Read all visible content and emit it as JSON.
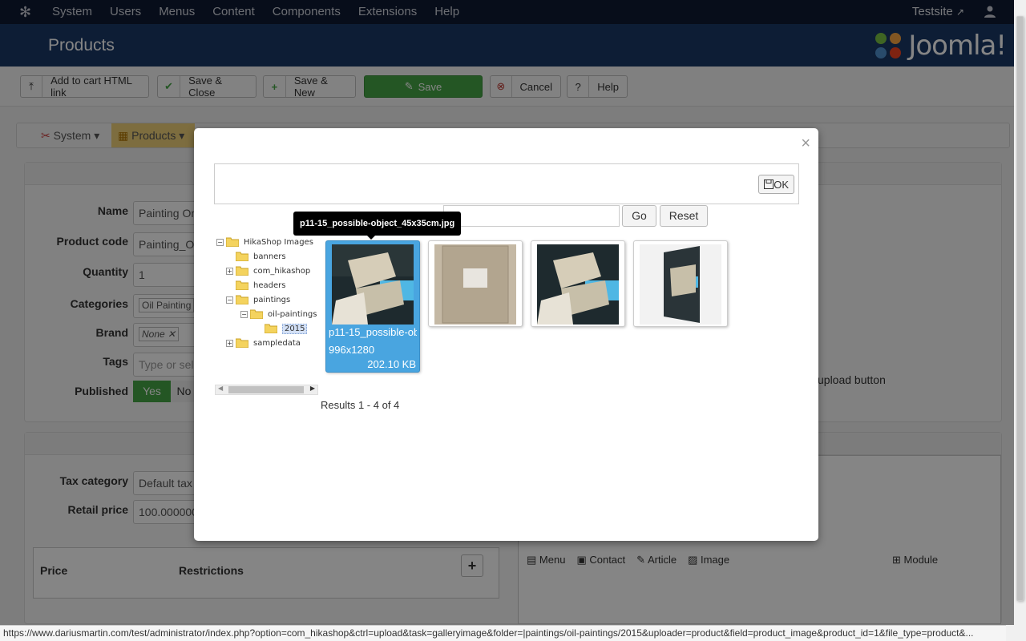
{
  "topnav": {
    "items": [
      "System",
      "Users",
      "Menus",
      "Content",
      "Components",
      "Extensions",
      "Help"
    ],
    "site_link": "Testsite"
  },
  "header": {
    "title": "Products",
    "brand": "Joomla!"
  },
  "toolbar": {
    "add_to_cart": "Add to cart HTML link",
    "save_close": "Save & Close",
    "save_new": "Save & New",
    "save": "Save",
    "cancel": "Cancel",
    "help": "Help"
  },
  "subnav": {
    "system": "System",
    "products": "Products"
  },
  "form": {
    "name_label": "Name",
    "name_value": "Painting On",
    "code_label": "Product code",
    "code_value": "Painting_On",
    "quantity_label": "Quantity",
    "quantity_value": "1",
    "categories_label": "Categories",
    "categories_value": "Oil Painting",
    "brand_label": "Brand",
    "brand_value": "None",
    "tags_label": "Tags",
    "tags_placeholder": "Type or sele",
    "published_label": "Published",
    "published_yes": "Yes",
    "published_no": "No",
    "upload_hint": "upload button",
    "tax_label": "Tax category",
    "tax_value": "Default tax",
    "price_label": "Retail price",
    "price_value": "100.000000",
    "price_col": "Price",
    "restrictions_col": "Restrictions",
    "editor_buttons": [
      "Module",
      "Menu",
      "Contact",
      "Article",
      "Image"
    ]
  },
  "modal": {
    "ok_label": "OK",
    "go_label": "Go",
    "reset_label": "Reset",
    "tooltip": "p11-15_possible-object_45x35cm.jpg",
    "tree": {
      "root": "HikaShop Images",
      "items": [
        "banners",
        "com_hikashop",
        "headers",
        "paintings",
        "oil-paintings",
        "2015",
        "sampledata"
      ]
    },
    "selected_image": {
      "name": "p11-15_possible-object_45x35cm.jpg",
      "dims": "996x1280",
      "size": "202.10 KB"
    },
    "results": "Results 1 - 4 of 4"
  },
  "statusbar": {
    "url": "https://www.dariusmartin.com/test/administrator/index.php?option=com_hikashop&ctrl=upload&task=galleryimage&folder=|paintings/oil-paintings/2015&uploader=product&field=product_image&product_id=1&file_type=product&..."
  },
  "colors": {
    "topnav": "#0f1a33",
    "header": "#1a3867",
    "save_green": "#46a546",
    "selected_blue": "#49a5e0"
  }
}
